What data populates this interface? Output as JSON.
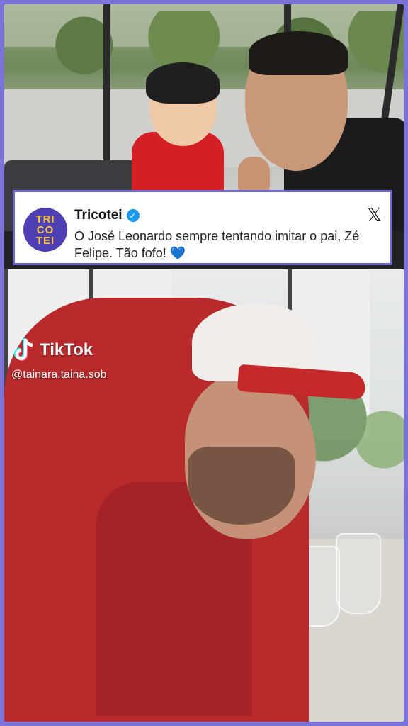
{
  "tweet": {
    "account_name": "Tricotei",
    "avatar_text": [
      "TRI",
      "CO",
      "TEI"
    ],
    "text": "O José Leonardo sempre tentando imitar o pai, Zé Felipe. Tão fofo!",
    "emoji": "💙",
    "platform_icon": "x-logo-icon",
    "verified_icon": "verified-badge-icon"
  },
  "watermark": {
    "label": "TikTok",
    "handle": "@tainara.taina.sob",
    "icon": "tiktok-note-icon"
  },
  "colors": {
    "border_accent": "#7b74d6",
    "avatar_bg": "#4f3fb5",
    "avatar_text": "#f7c531",
    "verified": "#1d9bf0",
    "heart": "#2a7fd4"
  }
}
